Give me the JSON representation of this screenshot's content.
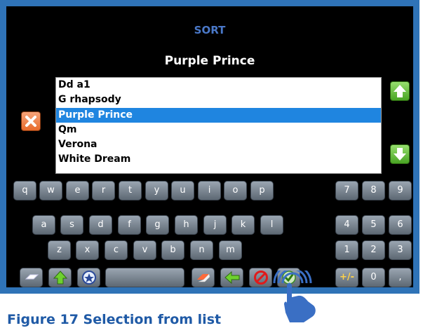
{
  "header": {
    "title": "SORT",
    "selected": "Purple Prince"
  },
  "list": {
    "items": [
      "Dd a1",
      "G rhapsody",
      "Purple Prince",
      "Qm",
      "Verona",
      "White Dream"
    ],
    "selected_index": 2
  },
  "keyboard": {
    "row1": [
      "q",
      "w",
      "e",
      "r",
      "t",
      "y",
      "u",
      "i",
      "o",
      "p"
    ],
    "row2": [
      "a",
      "s",
      "d",
      "f",
      "g",
      "h",
      "j",
      "k",
      "l"
    ],
    "row3": [
      "z",
      "x",
      "c",
      "v",
      "b",
      "n",
      "m"
    ],
    "numpad": [
      "7",
      "8",
      "9",
      "4",
      "5",
      "6",
      "1",
      "2",
      "3",
      "+/-",
      "0",
      ","
    ]
  },
  "caption": "Figure 17 Selection from list",
  "colors": {
    "frame": "#2f73b7",
    "title": "#4a78c8",
    "selection": "#1f85e0",
    "caption": "#1f5aa6"
  },
  "icons": [
    "cancel-icon",
    "arrow-up-icon",
    "arrow-down-icon",
    "clear-icon",
    "shift-icon",
    "special-char-icon",
    "eraser-icon",
    "backspace-icon",
    "stop-icon",
    "confirm-icon",
    "touch-hand-icon"
  ]
}
